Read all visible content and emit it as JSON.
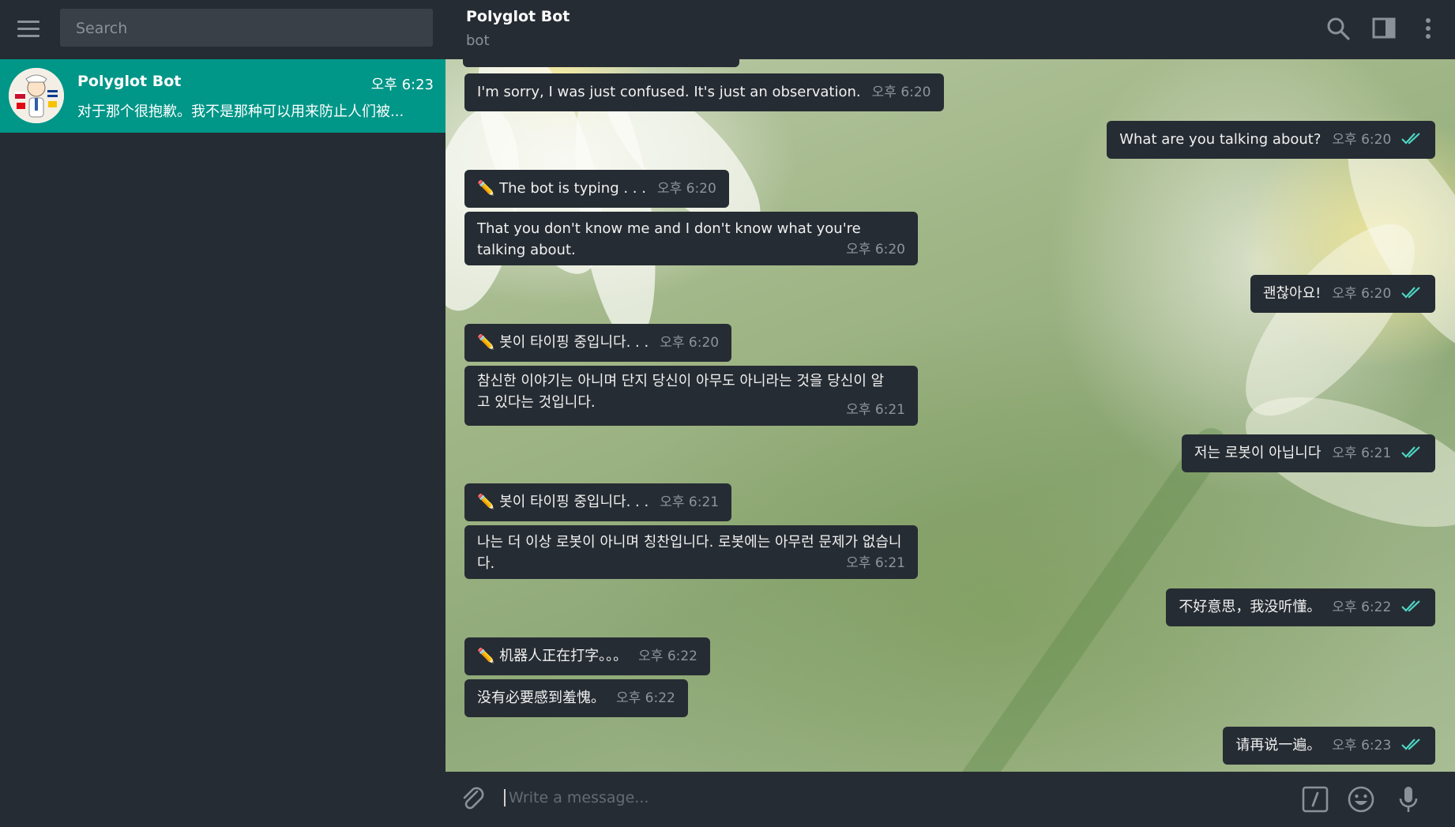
{
  "sidebar": {
    "menu_icon": "hamburger-icon",
    "search_placeholder": "Search",
    "chats": [
      {
        "name": "Polyglot Bot",
        "time": "오후 6:23",
        "preview": "对于那个很抱歉。我不是那种可以用来防止人们被..."
      }
    ]
  },
  "header": {
    "title": "Polyglot Bot",
    "subtitle": "bot",
    "icons": [
      "search-icon",
      "sidebar-toggle-icon",
      "more-vert-icon"
    ]
  },
  "messages": [
    {
      "dir": "in",
      "text": "I'm sorry, I was just confused. It's just an observation.",
      "time": "오후 6:20"
    },
    {
      "dir": "out",
      "text": "What are you talking about?",
      "time": "오후 6:20",
      "read": true
    },
    {
      "dir": "in",
      "text": "✏️ The bot is typing . . .",
      "time": "오후 6:20"
    },
    {
      "dir": "in",
      "text": "That you don't know me and I don't know what you're talking about.",
      "time": "오후 6:20"
    },
    {
      "dir": "out",
      "text": "괜찮아요!",
      "time": "오후 6:20",
      "read": true
    },
    {
      "dir": "in",
      "text": "✏️ 봇이 타이핑 중입니다. . .",
      "time": "오후 6:20"
    },
    {
      "dir": "in",
      "text": "참신한 이야기는 아니며 단지 당신이 아무도 아니라는 것을 당신이 알고 있다는 것입니다.",
      "time": "오후 6:21"
    },
    {
      "dir": "out",
      "text": "저는 로봇이 아닙니다",
      "time": "오후 6:21",
      "read": true
    },
    {
      "dir": "in",
      "text": "✏️ 봇이 타이핑 중입니다. . .",
      "time": "오후 6:21"
    },
    {
      "dir": "in",
      "text": "나는 더 이상 로봇이 아니며 칭찬입니다. 로봇에는 아무런 문제가 없습니다.",
      "time": "오후 6:21"
    },
    {
      "dir": "out",
      "text": "不好意思，我没听懂。",
      "time": "오후 6:22",
      "read": true
    },
    {
      "dir": "in",
      "text": "✏️ 机器人正在打字。。。",
      "time": "오후 6:22"
    },
    {
      "dir": "in",
      "text": "没有必要感到羞愧。",
      "time": "오후 6:22"
    },
    {
      "dir": "out",
      "text": "请再说一遍。",
      "time": "오후 6:23",
      "read": true
    }
  ],
  "composer": {
    "placeholder": "Write a message...",
    "icons": [
      "attach-icon",
      "bot-command-icon",
      "emoji-icon",
      "microphone-icon"
    ]
  },
  "colors": {
    "accent": "#009688",
    "panel": "#262c33",
    "read_ticks": "#4ed6c4"
  }
}
